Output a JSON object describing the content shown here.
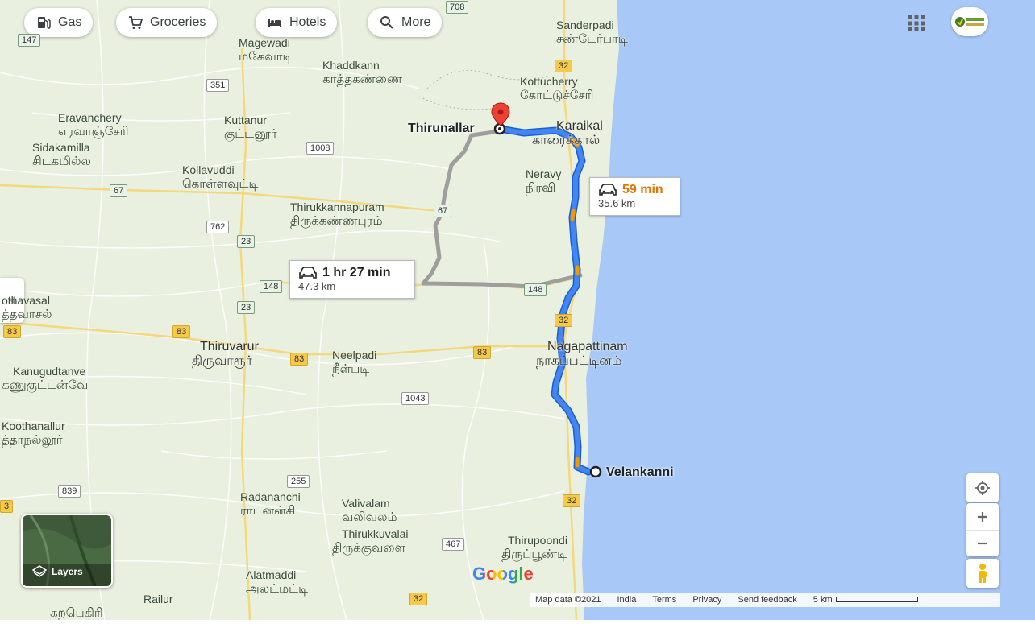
{
  "chips": [
    {
      "label": "Gas",
      "icon": "gas-station-icon"
    },
    {
      "label": "Groceries",
      "icon": "shopping-cart-icon"
    },
    {
      "label": "Hotels",
      "icon": "bed-icon"
    },
    {
      "label": "More",
      "icon": "search-icon"
    }
  ],
  "places": [
    {
      "en": "Sanderpadi",
      "ta": "சண்டேர்பாடி"
    },
    {
      "en": "Magewadi",
      "ta": "மகேவாடி"
    },
    {
      "en": "Khaddkann",
      "ta": "காத்தகண்ணை"
    },
    {
      "en": "Kottucherry",
      "ta": "கோட்டுச்சேரி"
    },
    {
      "en": "Eravanchery",
      "ta": "எரவாஞ்சேரி"
    },
    {
      "en": "Kuttanur",
      "ta": "குட்டனூர்"
    },
    {
      "en": "Sidakamilla",
      "ta": "சிடகமில்ல"
    },
    {
      "en": "Karaikal",
      "ta": "காரைக்கால்"
    },
    {
      "en": "Neravy",
      "ta": "நிரவி"
    },
    {
      "en": "Kollavuddi",
      "ta": "கொள்ளவுட்டி"
    },
    {
      "en": "Thirukkannapuram",
      "ta": "திருக்கண்ணபுரம்"
    },
    {
      "en": "othavasal",
      "ta": "த்தவாசல்"
    },
    {
      "en": "Thiruvarur",
      "ta": "திருவாரூர்"
    },
    {
      "en": "Neelpadi",
      "ta": "நீள்படி"
    },
    {
      "en": "Nagapattinam",
      "ta": "நாகப்பட்டினம்"
    },
    {
      "en": "Kanugudtanve",
      "ta": "கணுகுட்டன்வே"
    },
    {
      "en": "Koothanallur",
      "ta": "த்தாநல்லூர்"
    },
    {
      "en": "Radananchi",
      "ta": "ராடனன்சி"
    },
    {
      "en": "Valivalam",
      "ta": "வலிவலம்"
    },
    {
      "en": "Thirukkuvalai",
      "ta": "திருக்குவளை"
    },
    {
      "en": "Thirupoondi",
      "ta": "திருப்பூண்டி"
    },
    {
      "en": "Alatmaddi",
      "ta": "அலட்மட்டி"
    },
    {
      "en": "Railur",
      "ta": "கறபெகிரி"
    }
  ],
  "markers": {
    "origin": "Thirunallar",
    "destination": "Velankanni"
  },
  "routes": [
    {
      "time": "59 min",
      "distance": "35.6 km",
      "time_color": "#e37400"
    },
    {
      "time": "1 hr 27 min",
      "distance": "47.3 km",
      "time_color": "#202124"
    }
  ],
  "road_shields": {
    "s708": "708",
    "s147": "147",
    "s32a": "32",
    "s351": "351",
    "s1008": "1008",
    "s67a": "67",
    "s67b": "67",
    "s762": "762",
    "s23a": "23",
    "s148a": "148",
    "s148b": "148",
    "s23b": "23",
    "s32b": "32",
    "s83a": "83",
    "s83b": "83",
    "s83c": "83",
    "s83d": "83",
    "s1043": "1043",
    "s255": "255",
    "s839": "839",
    "s32c": "32",
    "s467": "467",
    "s32d": "32",
    "s3": "3"
  },
  "layers_label": "Layers",
  "google_logo": "Google",
  "footer": {
    "map_data": "Map data ©2021",
    "country": "India",
    "terms": "Terms",
    "privacy": "Privacy",
    "feedback": "Send feedback",
    "scale": "5 km"
  },
  "colors": {
    "land": "#e9f0df",
    "water": "#a8c8f8",
    "route_primary": "#4285f4",
    "route_alt": "#9e9e9e",
    "marker": "#ea4335"
  }
}
